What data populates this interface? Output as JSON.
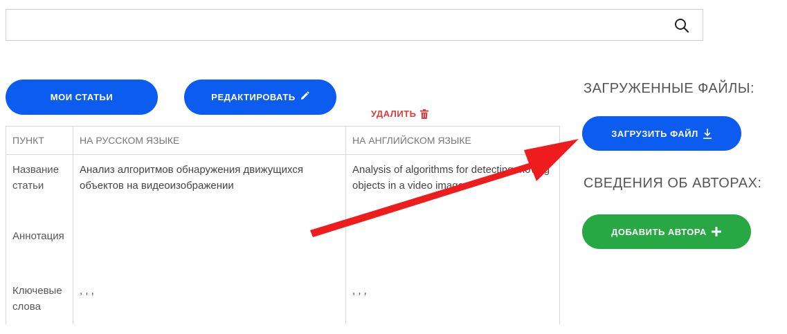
{
  "search": {
    "value": "",
    "placeholder": ""
  },
  "toolbar": {
    "my_articles_label": "МОИ СТАТЬИ",
    "edit_label": "РЕДАКТИРОВАТЬ",
    "delete_label": "УДАЛИТЬ"
  },
  "table": {
    "headers": [
      "ПУНКТ",
      "НА РУССКОМ ЯЗЫКЕ",
      "НА АНГЛИЙСКОМ ЯЗЫКЕ"
    ],
    "rows": [
      {
        "key": "Название статьи",
        "ru": "Анализ алгоритмов обнаружения движущихся объектов на видеоизображении",
        "en": "Analysis of algorithms for detecting moving objects in a video image"
      },
      {
        "key": "Аннотация",
        "ru": "",
        "en": ""
      },
      {
        "key": "Ключевые слова",
        "ru": ", , ,",
        "en": ", , ,"
      }
    ]
  },
  "files": {
    "title": "ЗАГРУЖЕННЫЕ ФАЙЛЫ:",
    "upload_label": "ЗАГРУЗИТЬ ФАЙЛ"
  },
  "authors": {
    "title": "СВЕДЕНИЯ ОБ АВТОРАХ:",
    "add_label": "ДОБАВИТЬ АВТОРА"
  },
  "colors": {
    "primary_button": "#0d5cf0",
    "success_button": "#27a844",
    "danger_text": "#e03a3a",
    "annotation_arrow": "#ee1c1c"
  },
  "icons": [
    "search-icon",
    "pencil-icon",
    "trash-icon",
    "download-icon",
    "plus-icon",
    "red-arrow-annotation"
  ]
}
